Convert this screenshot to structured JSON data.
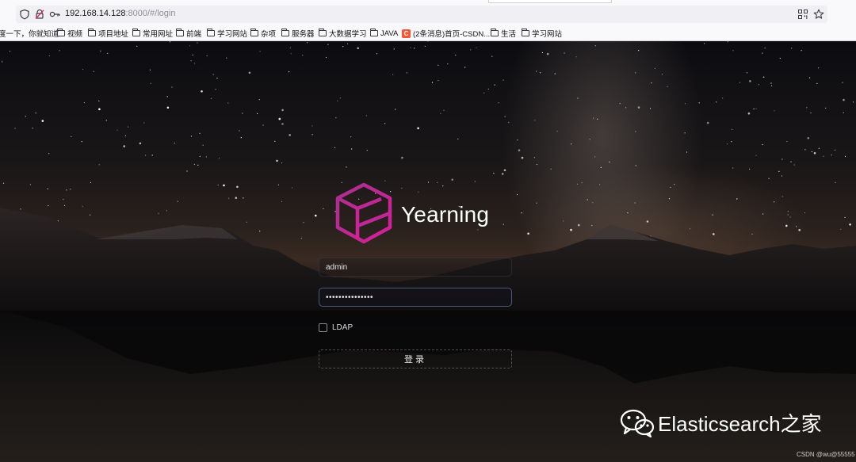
{
  "browser": {
    "url_host": "192.168.14.128",
    "url_rest": ":8000/#/login",
    "bookmarks": [
      {
        "label": "度一下，你就知道",
        "icon": "none"
      },
      {
        "label": "视频",
        "icon": "folder-icon"
      },
      {
        "label": "项目地址",
        "icon": "folder-icon"
      },
      {
        "label": "常用网址",
        "icon": "folder-icon"
      },
      {
        "label": "前端",
        "icon": "folder-icon"
      },
      {
        "label": "学习网站",
        "icon": "folder-icon"
      },
      {
        "label": "杂项",
        "icon": "folder-icon"
      },
      {
        "label": "服务器",
        "icon": "folder-icon"
      },
      {
        "label": "大数据学习",
        "icon": "folder-icon"
      },
      {
        "label": "JAVA",
        "icon": "folder-icon"
      },
      {
        "label": "(2条消息)首页-CSDN...",
        "icon": "csdn-icon"
      },
      {
        "label": "生活",
        "icon": "folder-icon"
      },
      {
        "label": "学习网站",
        "icon": "folder-icon"
      }
    ]
  },
  "login": {
    "brand": "Yearning",
    "username_value": "admin",
    "password_mask": "•••••••••••••••",
    "ldap_label": "LDAP",
    "ldap_checked": false,
    "submit_label": "登录"
  },
  "watermark": {
    "wechat_text": "Elasticsearch之家",
    "csdn_text": "CSDN @wu@55555"
  },
  "colors": {
    "logo_gradient_start": "#a8308f",
    "logo_gradient_end": "#d6209a",
    "csdn_red": "#fc5531"
  }
}
